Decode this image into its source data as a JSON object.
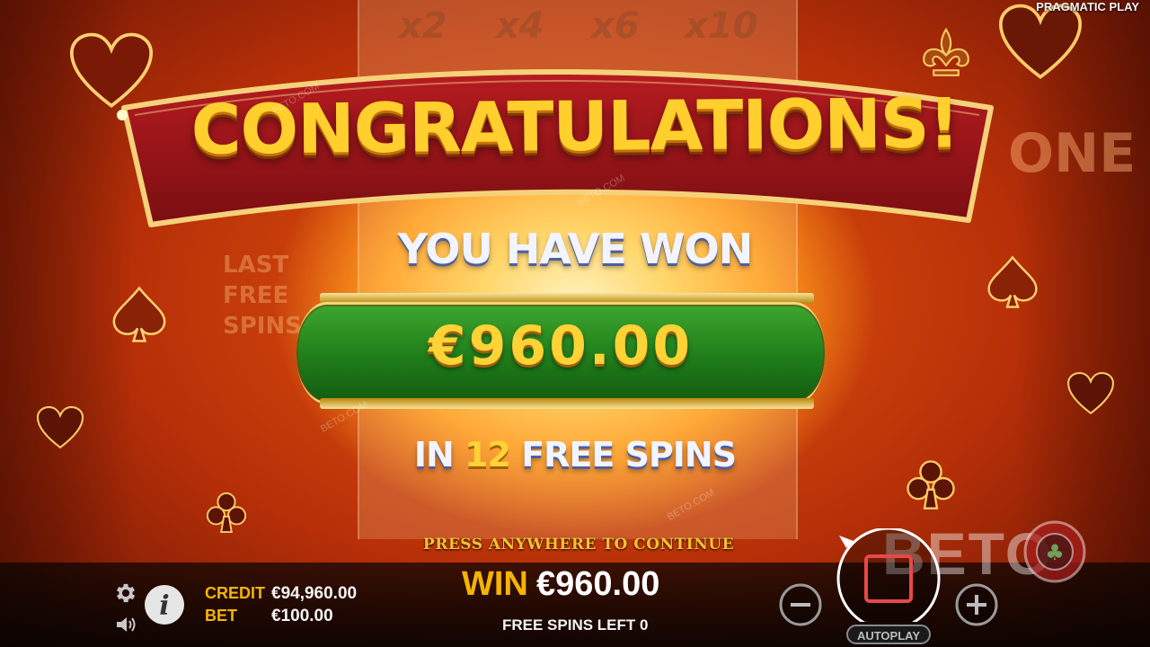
{
  "provider": {
    "name": "PRAGMATIC PLAY"
  },
  "background": {
    "multipliers": [
      "x2",
      "x4",
      "x6",
      "x10"
    ],
    "side_text": [
      "LAST",
      "FREE",
      "SPINS"
    ],
    "right_text": "ONE"
  },
  "popup": {
    "title": "CONGRATULATIONS!",
    "you_have_won": "YOU HAVE WON",
    "amount": "€960.00",
    "spins_prefix": "IN",
    "spins_count": "12",
    "spins_suffix": "FREE SPINS",
    "continue_prompt": "PRESS ANYWHERE TO CONTINUE"
  },
  "bar": {
    "credit_label": "CREDIT",
    "credit_value": "€94,960.00",
    "bet_label": "BET",
    "bet_value": "€100.00",
    "win_label": "WIN",
    "win_value": "€960.00",
    "free_spins_left": "FREE SPINS LEFT 0",
    "autoplay_label": "AUTOPLAY"
  },
  "icons": [
    "gear-icon",
    "speaker-icon",
    "info-icon",
    "minus-icon",
    "plus-icon",
    "stop-icon"
  ],
  "watermark": {
    "main": "BETO",
    "small": "BETO.COM"
  },
  "colors": {
    "gold": "#f5b400",
    "green_plate": "#1f7d1a",
    "banner_red": "#8e1518"
  }
}
